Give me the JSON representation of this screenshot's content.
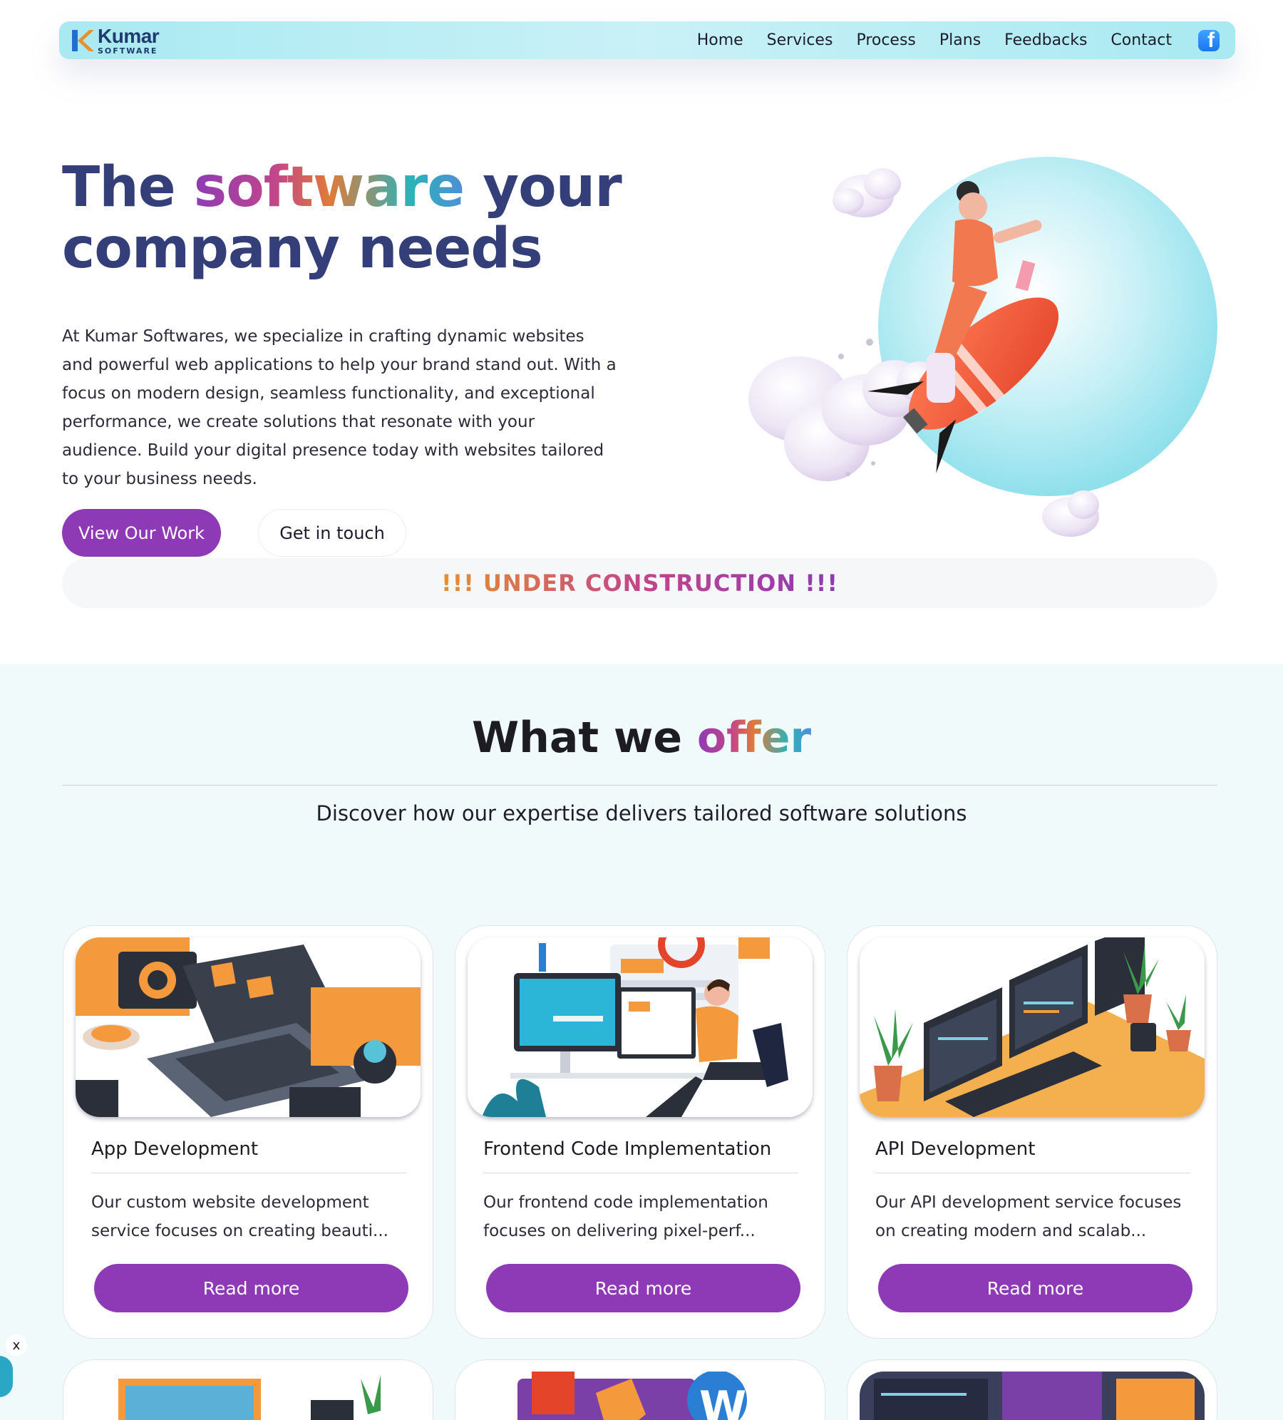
{
  "nav": {
    "logo_name": "Kumar",
    "logo_sub": "SOFTWARE",
    "links": [
      "Home",
      "Services",
      "Process",
      "Plans",
      "Feedbacks",
      "Contact"
    ],
    "social_icon": "facebook-icon"
  },
  "hero": {
    "title_part1": "The ",
    "title_highlight": "software",
    "title_part2": " your company needs",
    "description": "At Kumar Softwares, we specialize in crafting dynamic websites and powerful web applications to help your brand stand out. With a focus on modern design, seamless functionality, and exceptional performance, we create solutions that resonate with your audience. Build your digital presence today with websites tailored to your business needs.",
    "primary_button": "View Our Work",
    "secondary_button": "Get in touch",
    "notice": "!!! UNDER CONSTRUCTION !!!"
  },
  "offer": {
    "title_part1": "What we ",
    "title_highlight": "offer",
    "subtitle": "Discover how our expertise delivers tailored software solutions",
    "cards": [
      {
        "title": "App Development",
        "description": "Our custom website development service focuses on creating beauti...",
        "button": "Read more"
      },
      {
        "title": "Frontend Code Implementation",
        "description": "Our frontend code implementation focuses on delivering pixel-perf...",
        "button": "Read more"
      },
      {
        "title": "API Development",
        "description": "Our API development service focuses on creating modern and scalab...",
        "button": "Read more"
      }
    ]
  },
  "widget": {
    "close_label": "x"
  },
  "colors": {
    "accent": "#8e3ab6",
    "heading": "#343f7a",
    "nav_bg": "#a9e9f2",
    "section_bg": "#f1fafb"
  }
}
